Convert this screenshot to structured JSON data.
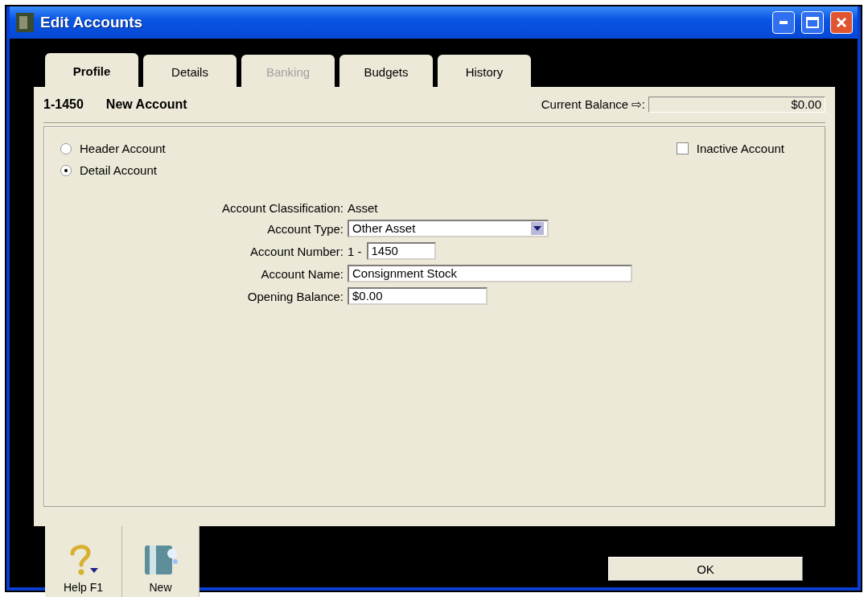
{
  "window": {
    "title": "Edit Accounts"
  },
  "tabs": [
    {
      "label": "Profile",
      "selected": true,
      "disabled": false
    },
    {
      "label": "Details",
      "selected": false,
      "disabled": false
    },
    {
      "label": "Banking",
      "selected": false,
      "disabled": true
    },
    {
      "label": "Budgets",
      "selected": false,
      "disabled": false
    },
    {
      "label": "History",
      "selected": false,
      "disabled": false
    }
  ],
  "header": {
    "account_number": "1-1450",
    "account_name": "New Account",
    "balance_label": "Current Balance ⇨:",
    "balance_value": "$0.00"
  },
  "account_level": [
    {
      "label": "Header Account",
      "selected": false
    },
    {
      "label": "Detail Account",
      "selected": true
    }
  ],
  "inactive": {
    "label": "Inactive Account",
    "checked": false
  },
  "form": {
    "classification_label": "Account Classification:",
    "classification_value": "Asset",
    "type_label": "Account Type:",
    "type_value": "Other Asset",
    "number_label": "Account Number:",
    "number_prefix": "1 -",
    "number_value": "1450",
    "name_label": "Account Name:",
    "name_value": "Consignment Stock",
    "opening_label": "Opening Balance:",
    "opening_value": "$0.00"
  },
  "toolbar": [
    {
      "kind": "help",
      "label": "Help F1"
    },
    {
      "kind": "new",
      "label": "New"
    }
  ],
  "ok_button": "OK"
}
